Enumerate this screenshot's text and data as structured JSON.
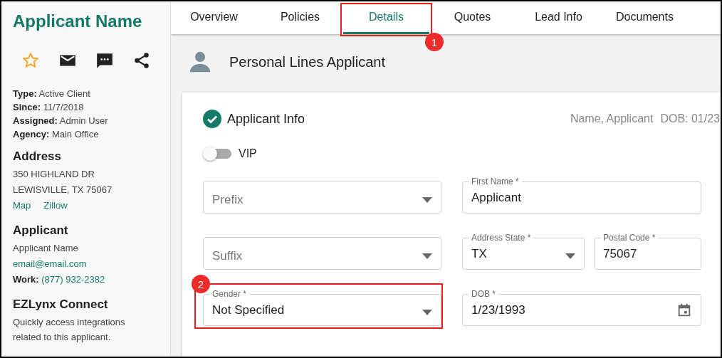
{
  "sidebar": {
    "title": "Applicant Name",
    "details": [
      "**Type:** Active Client",
      "**Since:** 11/7/2018",
      "**Assigned:** Admin User",
      "**Agency:** Main Office"
    ],
    "sections": [
      {
        "heading": "Address",
        "lines": [
          {
            "kind": "text",
            "text": "350 HIGHLAND DR"
          },
          {
            "kind": "text",
            "text": "LEWISVILLE, TX 75067"
          },
          {
            "kind": "links",
            "links": [
              "Map",
              "Zillow"
            ]
          }
        ]
      },
      {
        "heading": "Applicant",
        "lines": [
          {
            "kind": "text",
            "text": "Applicant Name"
          },
          {
            "kind": "link",
            "text": "email@email.com"
          },
          {
            "kind": "labeled_link",
            "label": "Work:",
            "text": "(877) 932-2382"
          }
        ]
      },
      {
        "heading": "EZLynx Connect",
        "lines": [
          {
            "kind": "text",
            "text": "Quickly access integrations related to this applicant."
          }
        ]
      }
    ]
  },
  "tabs": [
    {
      "label": "Overview",
      "selected": false
    },
    {
      "label": "Policies",
      "selected": false
    },
    {
      "label": "Details",
      "selected": true,
      "callout": "1"
    },
    {
      "label": "Quotes",
      "selected": false
    },
    {
      "label": "Lead Info",
      "selected": false
    },
    {
      "label": "Documents",
      "selected": false
    }
  ],
  "page_header": {
    "title": "Personal Lines Applicant"
  },
  "card": {
    "title": "Applicant Info",
    "complete": true,
    "summary": [
      "Name, Applicant",
      "DOB: 01/23"
    ],
    "vip": {
      "label": "VIP",
      "on": false
    },
    "rows": [
      [
        [
          {
            "kind": "select",
            "placeholder": "Prefix"
          }
        ],
        [
          {
            "kind": "text",
            "label": "First Name *",
            "value": "Applicant"
          }
        ]
      ],
      [
        [
          {
            "kind": "select",
            "placeholder": "Suffix"
          }
        ],
        [
          {
            "kind": "select",
            "label": "Address State *",
            "value": "TX"
          },
          {
            "kind": "text",
            "label": "Postal Code *",
            "value": "75067"
          }
        ]
      ],
      [
        [
          {
            "kind": "select",
            "label": "Gender *",
            "value": "Not Specified",
            "callout": "2"
          }
        ],
        [
          {
            "kind": "date",
            "label": "DOB *",
            "value": "1/23/1993"
          }
        ]
      ]
    ]
  }
}
